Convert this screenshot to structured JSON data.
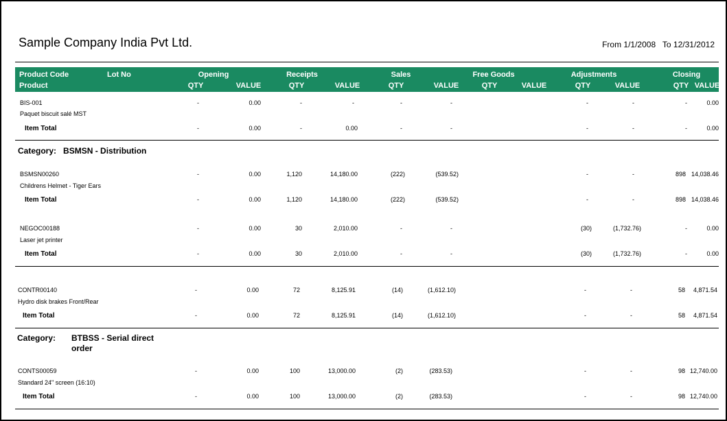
{
  "report": {
    "company": "Sample Company India Pvt Ltd.",
    "period_from": "From 1/1/2008",
    "period_to": "To 12/31/2012"
  },
  "columns": {
    "product_code": "Product Code",
    "lot_no": "Lot No",
    "product": "Product",
    "groups": [
      "Opening",
      "Receipts",
      "Sales",
      "Free Goods",
      "Adjustments",
      "Closing"
    ],
    "qty": "QTY",
    "value": "VALUE"
  },
  "item_total_label": "Item Total",
  "category_label": "Category:",
  "sections": [
    {
      "category": null,
      "items": [
        {
          "code": "BIS-001",
          "name": "Paquet biscuit salé MST",
          "values": [
            "-",
            "0.00",
            "-",
            "-",
            "-",
            "-",
            "-",
            "-",
            "-",
            "0.00"
          ],
          "totals": [
            "-",
            "0.00",
            "-",
            "0.00",
            "-",
            "-",
            "-",
            "-",
            "-",
            "0.00"
          ]
        }
      ]
    },
    {
      "category": "BSMSN - Distribution",
      "items": [
        {
          "code": "BSMSN00260",
          "name": "Childrens Helmet - Tiger Ears",
          "values": [
            "-",
            "0.00",
            "1,120",
            "14,180.00",
            "(222)",
            "(539.52)",
            "-",
            "-",
            "898",
            "14,038.46"
          ],
          "totals": [
            "-",
            "0.00",
            "1,120",
            "14,180.00",
            "(222)",
            "(539.52)",
            "-",
            "-",
            "898",
            "14,038.46"
          ]
        },
        {
          "code": "NEGOC00188",
          "name": "Laser jet printer",
          "values": [
            "-",
            "0.00",
            "30",
            "2,010.00",
            "-",
            "-",
            "(30)",
            "(1,732.76)",
            "-",
            "0.00"
          ],
          "totals": [
            "-",
            "0.00",
            "30",
            "2,010.00",
            "-",
            "-",
            "(30)",
            "(1,732.76)",
            "-",
            "0.00"
          ]
        }
      ]
    },
    {
      "category": null,
      "items": [
        {
          "code": "CONTR00140",
          "name": "Hydro disk brakes Front/Rear",
          "values": [
            "-",
            "0.00",
            "72",
            "8,125.91",
            "(14)",
            "(1,612.10)",
            "-",
            "-",
            "58",
            "4,871.54"
          ],
          "totals": [
            "-",
            "0.00",
            "72",
            "8,125.91",
            "(14)",
            "(1,612.10)",
            "-",
            "-",
            "58",
            "4,871.54"
          ]
        }
      ]
    },
    {
      "category": "BTBSS - Serial direct order",
      "category_line1": "BTBSS - Serial direct",
      "category_line2": "order",
      "items": [
        {
          "code": "CONTS00059",
          "name": "Standard 24\" screen (16:10)",
          "values": [
            "-",
            "0.00",
            "100",
            "13,000.00",
            "(2)",
            "(283.53)",
            "-",
            "-",
            "98",
            "12,740.00"
          ],
          "totals": [
            "-",
            "0.00",
            "100",
            "13,000.00",
            "(2)",
            "(283.53)",
            "-",
            "-",
            "98",
            "12,740.00"
          ]
        }
      ]
    }
  ]
}
